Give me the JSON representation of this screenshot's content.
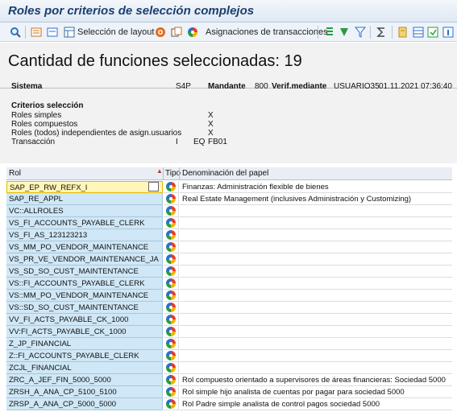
{
  "window": {
    "title": "Roles por criterios de selección complejos"
  },
  "toolbar": {
    "layout_label": "Selección de layout",
    "assign_label": "Asignaciones de transacciones"
  },
  "header": {
    "title": "Cantidad de funciones seleccionadas: 19",
    "sistema_label": "Sistema",
    "sistema_value": "S4P",
    "mandante_label": "Mandante",
    "mandante_value": "800",
    "verif_label": "Verif.mediante",
    "verif_user": "USUARIO35",
    "verif_date": "01.11.2021",
    "verif_time": "07:36:40",
    "criteria_heading": "Criterios selección",
    "criteria": [
      {
        "label": "Roles simples",
        "value": "X"
      },
      {
        "label": "Roles compuestos",
        "value": "X"
      },
      {
        "label": "Roles (todos) independientes de asign.usuarios",
        "value": "X"
      }
    ],
    "trans_label": "Transacción",
    "trans_incl": "I",
    "trans_op": "EQ",
    "trans_value": "FB01"
  },
  "grid": {
    "col_rol": "Rol",
    "col_tipo": "Tipo",
    "col_den": "Denominación del papel",
    "rows": [
      {
        "rol": "SAP_EP_RW_REFX_I",
        "den": "Finanzas: Administración flexible de bienes"
      },
      {
        "rol": "SAP_RE_APPL",
        "den": "Real Estate Management  (inclusives Administración y Customizing)"
      },
      {
        "rol": "VC::ALLROLES",
        "den": ""
      },
      {
        "rol": "VS_FI_ACCOUNTS_PAYABLE_CLERK",
        "den": ""
      },
      {
        "rol": "VS_FI_AS_123123213",
        "den": ""
      },
      {
        "rol": "VS_MM_PO_VENDOR_MAINTENANCE",
        "den": ""
      },
      {
        "rol": "VS_PR_VE_VENDOR_MAINTENANCE_JA",
        "den": ""
      },
      {
        "rol": "VS_SD_SO_CUST_MAINTENTANCE",
        "den": ""
      },
      {
        "rol": "VS::FI_ACCOUNTS_PAYABLE_CLERK",
        "den": ""
      },
      {
        "rol": "VS::MM_PO_VENDOR_MAINTENANCE",
        "den": ""
      },
      {
        "rol": "VS::SD_SO_CUST_MAINTENTANCE",
        "den": ""
      },
      {
        "rol": "VV_FI_ACTS_PAYABLE_CK_1000",
        "den": ""
      },
      {
        "rol": "VV:FI_ACTS_PAYABLE_CK_1000",
        "den": ""
      },
      {
        "rol": "Z_JP_FINANCIAL",
        "den": ""
      },
      {
        "rol": "Z::FI_ACCOUNTS_PAYABLE_CLERK",
        "den": ""
      },
      {
        "rol": "ZCJL_FINANCIAL",
        "den": ""
      },
      {
        "rol": "ZRC_A_JEF_FIN_5000_5000",
        "den": "Rol compuesto orientado a supervisores de áreas financieras: Sociedad 5000"
      },
      {
        "rol": "ZRSH_A_ANA_CP_5100_5100",
        "den": "Rol simple hijo analista de cuentas por pagar para sociedad 5000"
      },
      {
        "rol": "ZRSP_A_ANA_CP_5000_5000",
        "den": "Rol Padre simple analista de control pagos sociedad 5000"
      }
    ]
  }
}
